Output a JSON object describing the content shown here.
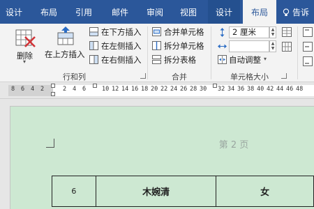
{
  "tabs": [
    "设计",
    "布局",
    "引用",
    "邮件",
    "审阅",
    "视图",
    "设计",
    "布局"
  ],
  "active_tab_index": 7,
  "tell_me": "告诉我",
  "ribbon": {
    "delete_label": "删除",
    "insert_above_label": "在上方插入",
    "insert_below_label": "在下方插入",
    "insert_left_label": "在左侧插入",
    "insert_right_label": "在右侧插入",
    "rows_cols_group": "行和列",
    "merge_cells_label": "合并单元格",
    "split_cells_label": "拆分单元格",
    "split_table_label": "拆分表格",
    "merge_group": "合并",
    "row_height_value": "2 厘米",
    "col_width_value": "",
    "autofit_label": "自动调整",
    "cell_size_group": "单元格大小"
  },
  "ruler_numbers": [
    "8",
    "6",
    "4",
    "2",
    "2",
    "4",
    "6",
    "10",
    "12",
    "14",
    "16",
    "18",
    "20",
    "22",
    "24",
    "26",
    "28",
    "30",
    "32",
    "34",
    "36",
    "38",
    "40",
    "42",
    "44",
    "46",
    "48"
  ],
  "document": {
    "page_label": "第 2 页",
    "table_row": [
      "6",
      "木婉清",
      "女"
    ]
  },
  "colors": {
    "tab_bar": "#2b579a",
    "page_background": "#cde8d2",
    "ribbon": "#f3f3f3"
  }
}
